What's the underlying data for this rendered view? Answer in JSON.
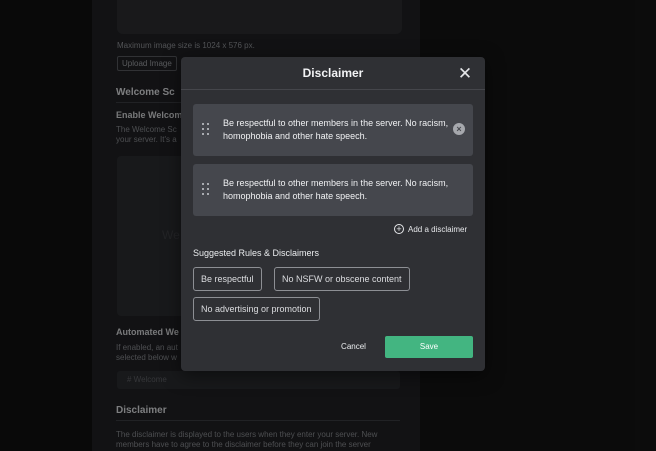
{
  "background": {
    "image_note": "Maximum image size is 1024 x 576 px.",
    "upload_label": "Upload Image",
    "welcome_heading": "Welcome Sc",
    "enable_welcome_label": "Enable Welcom",
    "welcome_desc_line1": "The Welcome Sc",
    "welcome_desc_line2": "your server. It's a",
    "image_placeholder": "We",
    "automated_heading": "Automated We",
    "automated_desc_line1": "If enabled, an aut",
    "automated_desc_line2": "selected below w",
    "channel_select": "# Welcome",
    "disclaimer_heading": "Disclaimer",
    "disclaimer_desc_line1": "The disclaimer is displayed to the users when they enter your server. New",
    "disclaimer_desc_line2": "members have to agree to the disclaimer before they can join the server"
  },
  "modal": {
    "title": "Disclaimer",
    "rules": [
      {
        "text": "Be respectful to other members in the server. No racism, homophobia and other hate speech."
      },
      {
        "text": "Be respectful to other members in the server. No racism, homophobia and other hate speech."
      }
    ],
    "add_label": "Add a disclaimer",
    "suggest_title": "Suggested Rules & Disclaimers",
    "suggestions": [
      "Be respectful",
      "No NSFW or obscene content",
      "No advertising or promotion"
    ],
    "cancel_label": "Cancel",
    "save_label": "Save"
  },
  "colors": {
    "accent": "#43b581",
    "modal_bg": "#2f3034",
    "card_bg": "#45474d"
  }
}
